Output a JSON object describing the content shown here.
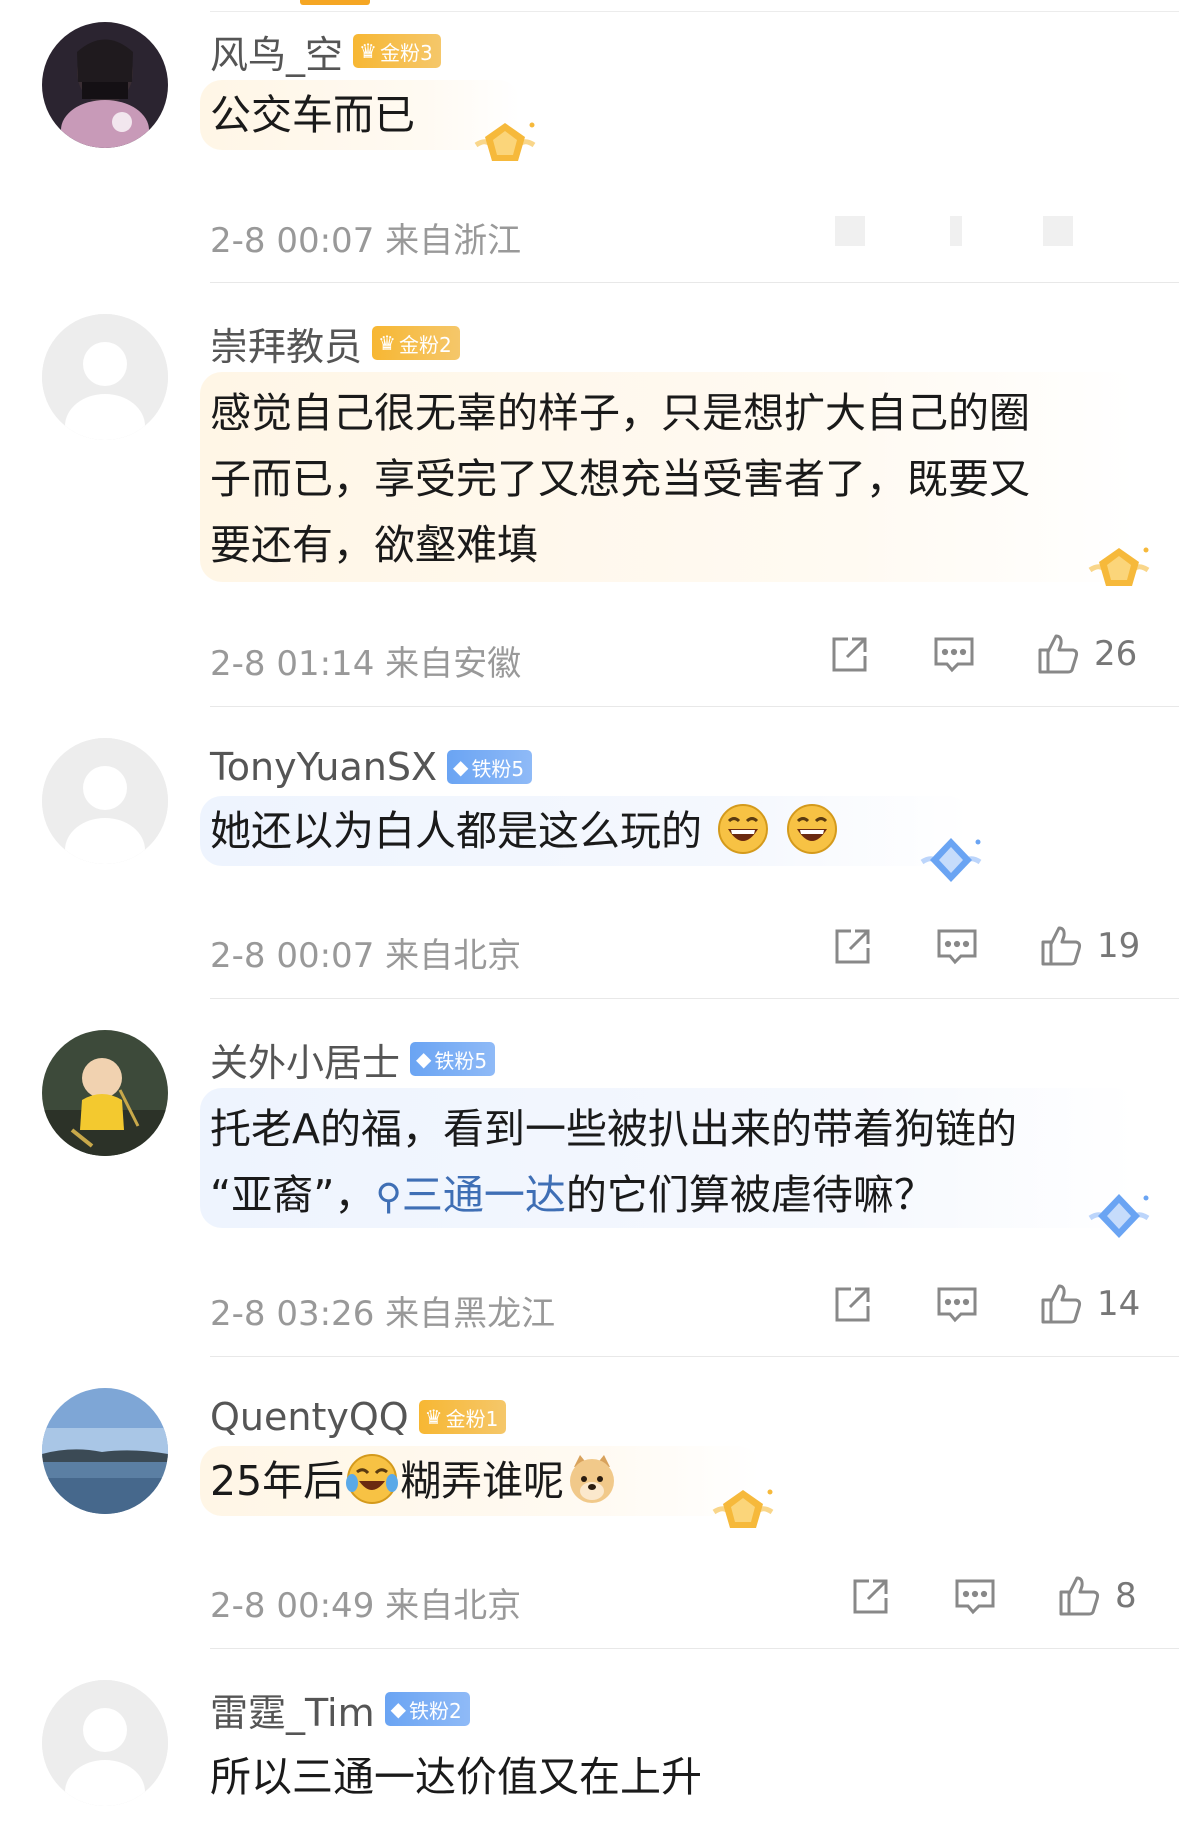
{
  "comments": [
    {
      "username": "风鸟_空",
      "badge": {
        "label": "金粉3",
        "type": "gold"
      },
      "text": [
        "公交车而已"
      ],
      "time": "2-8 00:07",
      "location": "来自浙江",
      "likes": null
    },
    {
      "username": "崇拜教员",
      "badge": {
        "label": "金粉2",
        "type": "gold"
      },
      "text": [
        "感觉自己很无辜的样子，只是想扩大自己的圈",
        "子而已，享受完了又想充当受害者了，既要又",
        "要还有，欲壑难填"
      ],
      "time": "2-8 01:14",
      "location": "来自安徽",
      "likes": "26"
    },
    {
      "username": "TonyYuanSX",
      "badge": {
        "label": "铁粉5",
        "type": "iron"
      },
      "text": [
        "她还以为白人都是这么玩的"
      ],
      "time": "2-8 00:07",
      "location": "来自北京",
      "likes": "19"
    },
    {
      "username": "关外小居士",
      "badge": {
        "label": "铁粉5",
        "type": "iron"
      },
      "text": [
        "托老A的福，看到一些被扒出来的带着狗链的",
        "“亚裔”，",
        "三通一达",
        "的它们算被虐待嘛？"
      ],
      "time": "2-8 03:26",
      "location": "来自黑龙江",
      "likes": "14"
    },
    {
      "username": "QuentyQQ",
      "badge": {
        "label": "金粉1",
        "type": "gold"
      },
      "text": [
        "25年后",
        "糊弄谁呢"
      ],
      "time": "2-8 00:49",
      "location": "来自北京",
      "likes": "8"
    },
    {
      "username": "雷霆_Tim",
      "badge": {
        "label": "铁粉2",
        "type": "iron"
      },
      "text": [
        "所以三通一达价值又在上升"
      ],
      "time": null,
      "location": null,
      "likes": null
    }
  ],
  "icons": {
    "share": "share-icon",
    "comment": "comment-icon",
    "like": "thumbs-up-icon"
  },
  "colors": {
    "gold_badge": "#f7b733",
    "iron_badge": "#6aa4f3",
    "link": "#3f6fb5",
    "meta_text": "#999999"
  }
}
